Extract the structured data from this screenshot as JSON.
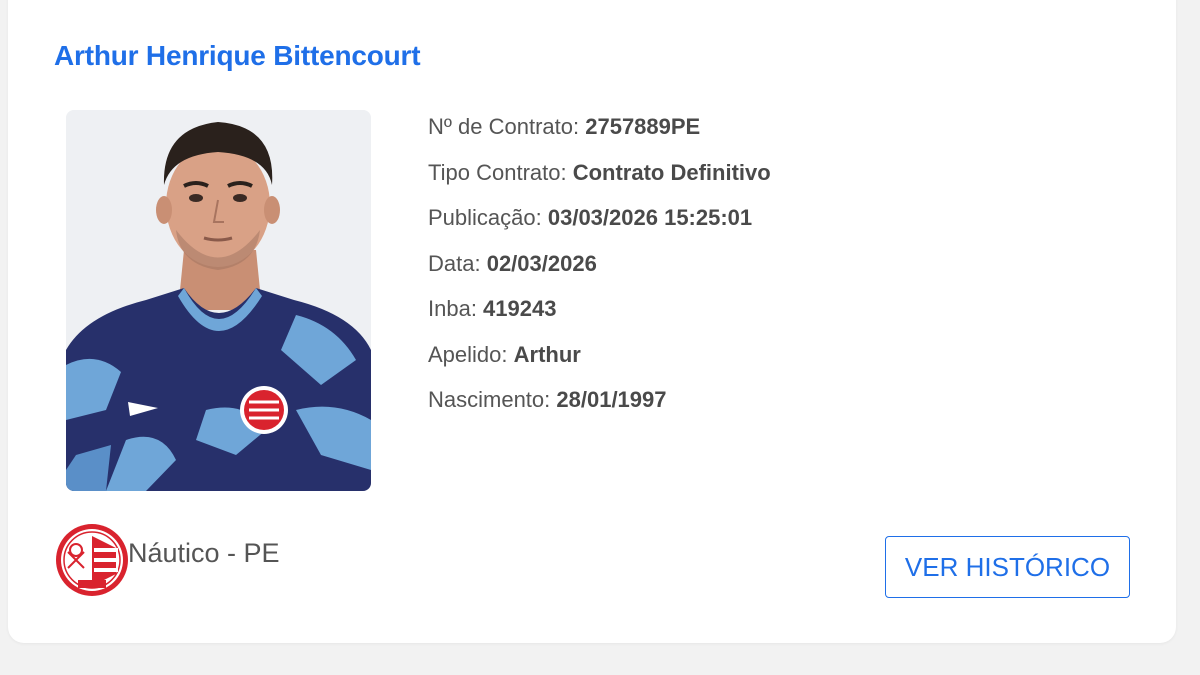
{
  "player": {
    "name": "Arthur Henrique Bittencourt",
    "photo_alt": "player-photo"
  },
  "info": [
    {
      "label": "Nº de Contrato: ",
      "value": "2757889PE"
    },
    {
      "label": "Tipo Contrato: ",
      "value": "Contrato Definitivo"
    },
    {
      "label": "Publicação: ",
      "value": "03/03/2026 15:25:01"
    },
    {
      "label": "Data: ",
      "value": "02/03/2026"
    },
    {
      "label": "Inba: ",
      "value": "419243"
    },
    {
      "label": "Apelido: ",
      "value": "Arthur"
    },
    {
      "label": "Nascimento: ",
      "value": "28/01/1997"
    }
  ],
  "club": {
    "name": "Náutico - PE",
    "logo_icon": "nautico-crest-icon"
  },
  "actions": {
    "history_label": "VER HISTÓRICO"
  },
  "colors": {
    "accent": "#1f6fe8",
    "club_red": "#d9232e",
    "jersey_navy": "#27306b",
    "jersey_light": "#6fa6d8"
  }
}
